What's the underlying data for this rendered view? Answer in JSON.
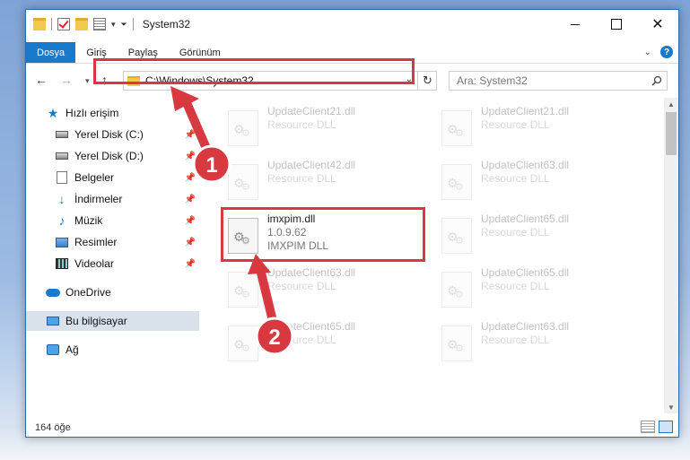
{
  "window": {
    "title": "System32"
  },
  "ribbon": {
    "tabs": [
      "Dosya",
      "Giriş",
      "Paylaş",
      "Görünüm"
    ]
  },
  "address": {
    "path": "C:\\Windows\\System32"
  },
  "search": {
    "placeholder": "Ara: System32"
  },
  "nav": {
    "quick_access": "Hızlı erişim",
    "items": [
      "Yerel Disk (C:)",
      "Yerel Disk (D:)",
      "Belgeler",
      "İndirmeler",
      "Müzik",
      "Resimler",
      "Videolar"
    ],
    "onedrive": "OneDrive",
    "this_pc": "Bu bilgisayar",
    "network": "Ağ"
  },
  "files": [
    {
      "name": "UpdateClient21.dll",
      "sub": "Resource DLL"
    },
    {
      "name": "UpdateClient21.dll",
      "sub": "Resource DLL"
    },
    {
      "name": "UpdateClient42.dll",
      "sub": "Resource DLL"
    },
    {
      "name": "UpdateClient63.dll",
      "sub": "Resource DLL"
    },
    {
      "name": "imxpim.dll",
      "version": "1.0.9.62",
      "sub": "IMXPIM DLL"
    },
    {
      "name": "UpdateClient65.dll",
      "sub": "Resource DLL"
    },
    {
      "name": "UpdateClient63.dll",
      "sub": "Resource DLL"
    },
    {
      "name": "UpdateClient65.dll",
      "sub": "Resource DLL"
    },
    {
      "name": "UpdateClient65.dll",
      "sub": "Resource DLL"
    },
    {
      "name": "UpdateClient63.dll",
      "sub": "Resource DLL"
    }
  ],
  "status": {
    "count": "164 öğe"
  },
  "annotations": {
    "step1": "1",
    "step2": "2",
    "highlight_color": "#d8383f"
  },
  "colors": {
    "accent": "#1979ca"
  }
}
